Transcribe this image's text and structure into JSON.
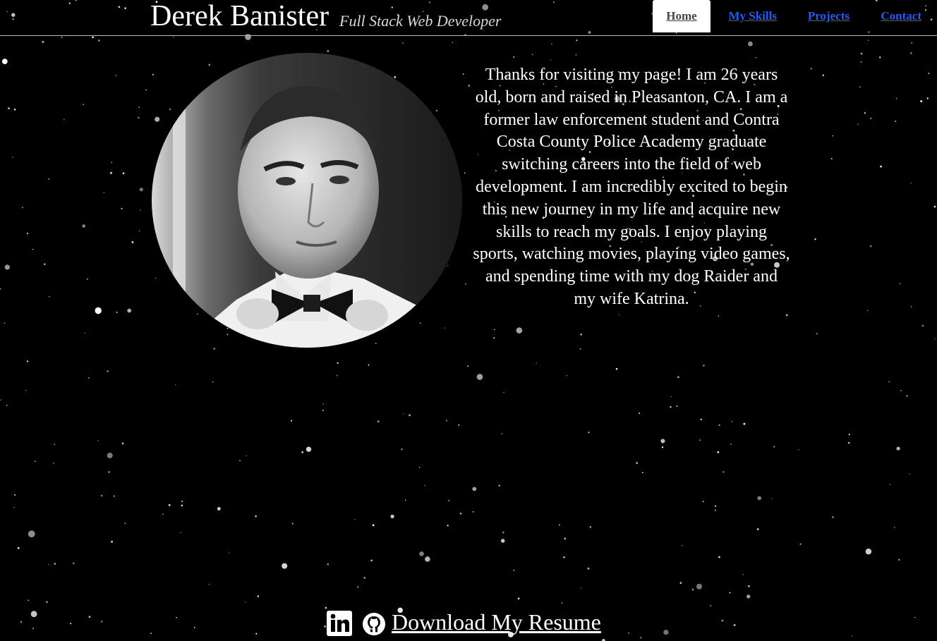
{
  "header": {
    "name": "Derek Banister",
    "tagline": "Full Stack Web Developer"
  },
  "nav": {
    "items": [
      {
        "label": "Home",
        "active": true
      },
      {
        "label": "My Skills",
        "active": false
      },
      {
        "label": "Projects",
        "active": false
      },
      {
        "label": "Contact",
        "active": false
      }
    ]
  },
  "main": {
    "bio": "Thanks for visiting my page! I am 26 years old, born and raised in Pleasanton, CA. I am a former law enforcement student and Contra Costa County Police Academy graduate switching careers into the field of web development. I am incredibly excited to begin this new journey in my life and acquire new skills to reach my goals. I enjoy playing sports, watching movies, playing video games, and spending time with my dog Raider and my wife Katrina."
  },
  "footer": {
    "linkedin_icon": "linkedin-icon",
    "github_icon": "github-icon",
    "resume_label": "Download My Resume"
  },
  "colors": {
    "background": "#000000",
    "link": "#1a5cff",
    "text": "#ffffff"
  }
}
